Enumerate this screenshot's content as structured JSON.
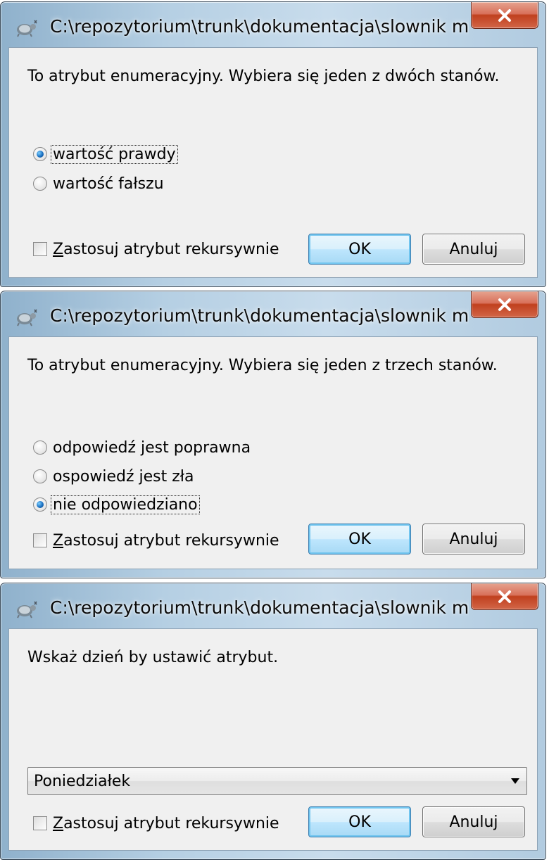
{
  "dialogs": [
    {
      "title": "C:\\repozytorium\\trunk\\dokumentacja\\slownik miejscow...",
      "description": "To atrybut enumeracyjny. Wybiera się jeden z dwóch stanów.",
      "options": [
        {
          "label": "wartość prawdy",
          "selected": true
        },
        {
          "label": "wartość fałszu",
          "selected": false
        }
      ],
      "recursive_prefix": "Z",
      "recursive_rest": "astosuj atrybut rekursywnie",
      "ok": "OK",
      "cancel": "Anuluj"
    },
    {
      "title": "C:\\repozytorium\\trunk\\dokumentacja\\slownik miejscow...",
      "description": "To atrybut enumeracyjny. Wybiera się jeden z trzech stanów.",
      "options": [
        {
          "label": "odpowiedź jest poprawna",
          "selected": false
        },
        {
          "label": "ospowiedź jest zła",
          "selected": false
        },
        {
          "label": "nie odpowiedziano",
          "selected": true
        }
      ],
      "recursive_prefix": "Z",
      "recursive_rest": "astosuj atrybut rekursywnie",
      "ok": "OK",
      "cancel": "Anuluj"
    },
    {
      "title": "C:\\repozytorium\\trunk\\dokumentacja\\slownik miejscow...",
      "description": "Wskaż dzień by ustawić atrybut.",
      "select_value": "Poniedziałek",
      "recursive_prefix": "Z",
      "recursive_rest": "astosuj atrybut rekursywnie",
      "ok": "OK",
      "cancel": "Anuluj"
    }
  ],
  "icons": {
    "app": "tortoisesvn-icon",
    "close": "close-icon",
    "dropdown": "chevron-down-icon"
  },
  "colors": {
    "close_button": "#c7472c",
    "default_button_border": "#3c7fb1",
    "client_background": "#f0f0f0"
  }
}
